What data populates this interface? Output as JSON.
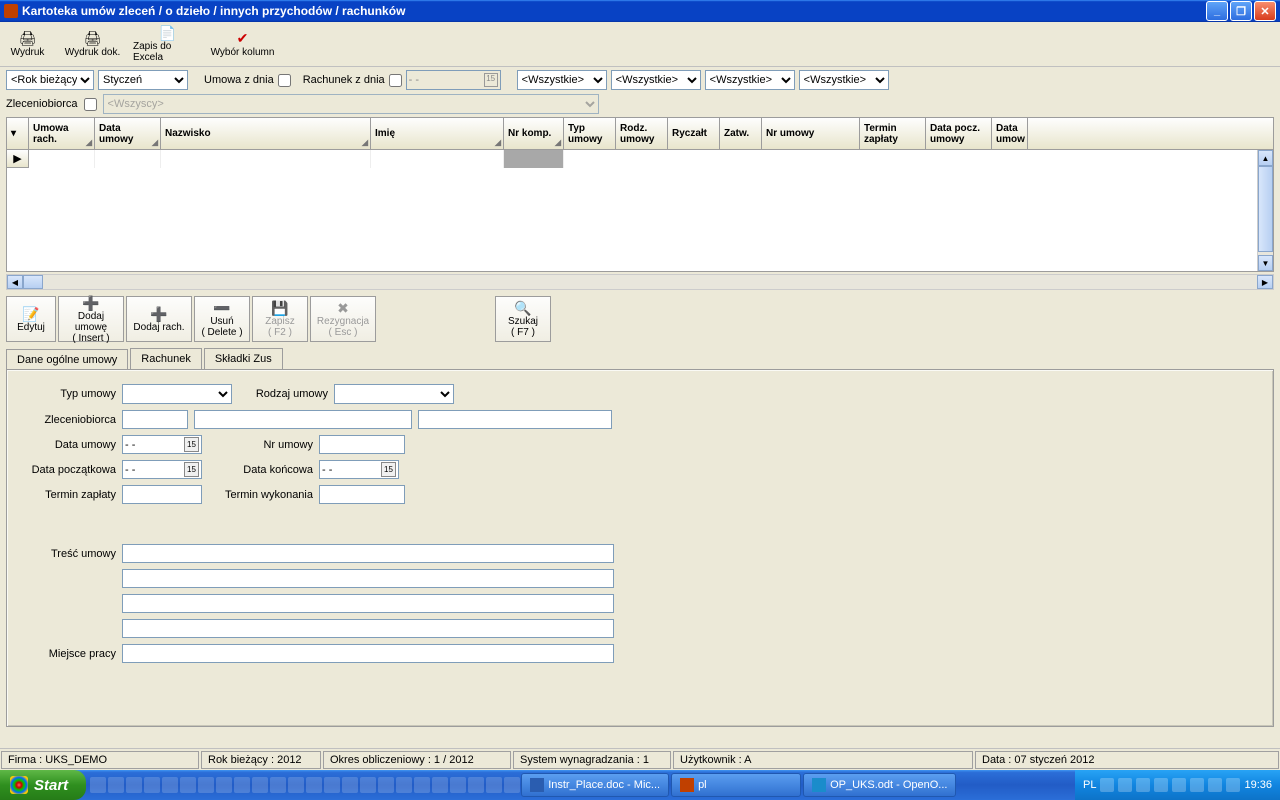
{
  "title": "Kartoteka umów zleceń / o dzieło / innych przychodów / rachunków",
  "toolbar1": {
    "wydruk": "Wydruk",
    "wydruk_dok": "Wydruk dok.",
    "zapis_excel": "Zapis do Excela",
    "wybor_kolumn": "Wybór kolumn"
  },
  "filter": {
    "rok": "<Rok bieżący>",
    "miesiac": "Styczeń",
    "umowa_z_dnia_label": "Umowa z dnia",
    "rachunek_z_dnia_label": "Rachunek  z dnia",
    "date_blank": "  -  -",
    "wszystkie": "<Wszystkie>"
  },
  "zlec": {
    "label": "Zleceniobiorca",
    "all": "<Wszyscy>"
  },
  "columns": {
    "umowa_rach": "Umowa rach.",
    "data_umowy": "Data umowy",
    "nazwisko": "Nazwisko",
    "imie": "Imię",
    "nr_komp": "Nr komp.",
    "typ_umowy": "Typ umowy",
    "rodz_umowy": "Rodz. umowy",
    "ryczalt": "Ryczałt",
    "zatw": "Zatw.",
    "nr_umowy": "Nr umowy",
    "termin_zaplaty": "Termin zapłaty",
    "data_pocz": "Data pocz. umowy",
    "data_umow2": "Data umow"
  },
  "toolbar2": {
    "edytuj": "Edytuj",
    "dodaj_umowe": "Dodaj umowę",
    "dodaj_umowe_sub": "( Insert )",
    "dodaj_rach": "Dodaj rach.",
    "usun": "Usuń",
    "usun_sub": "( Delete )",
    "zapisz": "Zapisz",
    "zapisz_sub": "( F2 )",
    "rezygnacja": "Rezygnacja",
    "rezygnacja_sub": "( Esc )",
    "szukaj": "Szukaj",
    "szukaj_sub": "( F7 )"
  },
  "tabs": {
    "dane": "Dane ogólne umowy",
    "rachunek": "Rachunek",
    "skladki": "Składki Zus"
  },
  "form": {
    "typ_umowy": "Typ umowy",
    "rodzaj_umowy": "Rodzaj umowy",
    "zleceniobiorca": "Zleceniobiorca",
    "data_umowy": "Data umowy",
    "nr_umowy": "Nr umowy",
    "data_pocz": "Data początkowa",
    "data_konc": "Data końcowa",
    "termin_zaplaty": "Termin zapłaty",
    "termin_wykonania": "Termin wykonania",
    "tresc_umowy": "Treść umowy",
    "miejsce_pracy": "Miejsce pracy",
    "date_blank": "  -  -"
  },
  "status": {
    "firma": "Firma : UKS_DEMO",
    "rok": "Rok bieżący : 2012",
    "okres": "Okres obliczeniowy : 1 / 2012",
    "system": "System wynagradzania : 1",
    "uzytkownik": "Użytkownik : A",
    "data": "Data : 07 styczeń 2012"
  },
  "taskbar": {
    "start": "Start",
    "task1": "Instr_Place.doc - Mic...",
    "task2": "pl",
    "task3": "OP_UKS.odt - OpenO...",
    "lang": "PL",
    "clock": "19:36"
  }
}
